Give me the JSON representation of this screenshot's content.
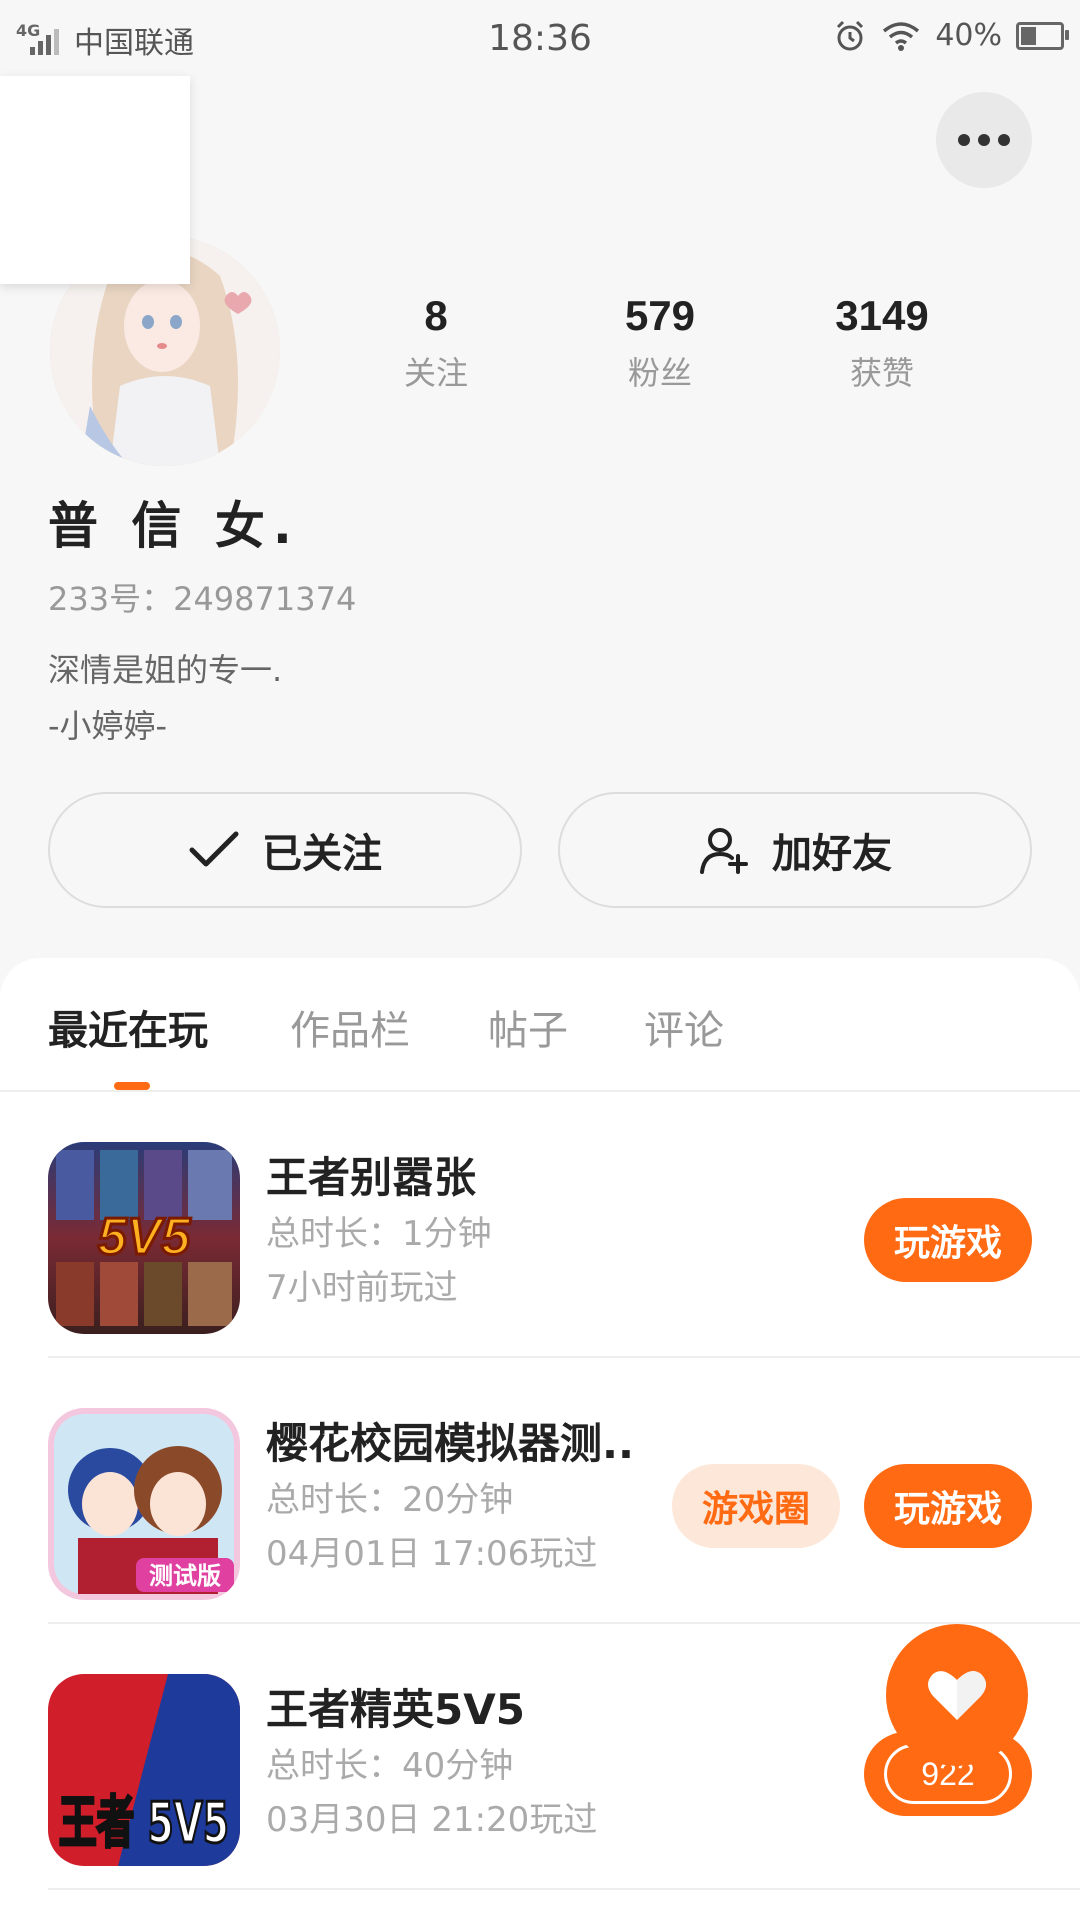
{
  "status_bar": {
    "network": "4G",
    "carrier": "中国联通",
    "time": "18:36",
    "battery_percent": "40%",
    "battery_level": 0.4,
    "icons": [
      "alarm-icon",
      "wifi-icon",
      "battery-icon"
    ]
  },
  "profile": {
    "stats": [
      {
        "value": "8",
        "label": "关注"
      },
      {
        "value": "579",
        "label": "粉丝"
      },
      {
        "value": "3149",
        "label": "获赞"
      }
    ],
    "username": "普 信 女.",
    "id_line": "233号：249871374",
    "bio_lines": [
      "深情是姐的专一.",
      "-小婷婷-"
    ]
  },
  "actions": {
    "followed_label": "已关注",
    "add_friend_label": "加好友"
  },
  "tabs": [
    {
      "label": "最近在玩",
      "active": true
    },
    {
      "label": "作品栏",
      "active": false
    },
    {
      "label": "帖子",
      "active": false
    },
    {
      "label": "评论",
      "active": false
    }
  ],
  "games": [
    {
      "name": "王者别嚣张",
      "duration": "总时长：1分钟",
      "last_played": "7小时前玩过",
      "play_label": "玩游戏",
      "circle_label": null,
      "icon_text": "5V5"
    },
    {
      "name": "樱花校园模拟器测...",
      "duration": "总时长：20分钟",
      "last_played": "04月01日 17:06玩过",
      "play_label": "玩游戏",
      "circle_label": "游戏圈",
      "icon_text": "测试版"
    },
    {
      "name": "王者精英5V5",
      "duration": "总时长：40分钟",
      "last_played": "03月30日 21:20玩过",
      "play_label": "",
      "circle_label": null,
      "icon_text": "王者 5V5"
    }
  ],
  "fab": {
    "count": "922"
  },
  "colors": {
    "accent": "#ff6a13",
    "accent_light": "#fde7d8",
    "background": "#f7f7f7"
  }
}
